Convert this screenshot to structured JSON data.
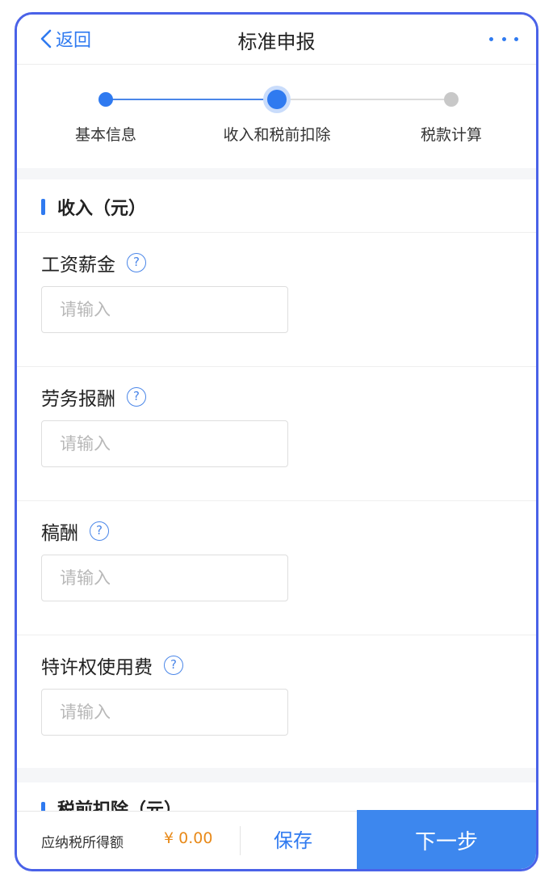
{
  "header": {
    "back_label": "返回",
    "title": "标准申报",
    "more_icon": "more-dots-icon"
  },
  "stepper": {
    "steps": [
      {
        "label": "基本信息",
        "state": "done"
      },
      {
        "label": "收入和税前扣除",
        "state": "current"
      },
      {
        "label": "税款计算",
        "state": "todo"
      }
    ]
  },
  "income": {
    "title": "收入（元）",
    "fields": [
      {
        "label": "工资薪金",
        "placeholder": "请输入",
        "value": ""
      },
      {
        "label": "劳务报酬",
        "placeholder": "请输入",
        "value": ""
      },
      {
        "label": "稿酬",
        "placeholder": "请输入",
        "value": ""
      },
      {
        "label": "特许权使用费",
        "placeholder": "请输入",
        "value": ""
      }
    ]
  },
  "deduction": {
    "title": "税前扣除（元）"
  },
  "footer": {
    "taxable_label": "应纳税所得额",
    "taxable_value": "¥ 0.00",
    "save_label": "保存",
    "next_label": "下一步"
  },
  "colors": {
    "accent": "#2f7af0",
    "frame": "#4a62e8",
    "amount": "#e88a1a",
    "next_button": "#3d87ee"
  }
}
